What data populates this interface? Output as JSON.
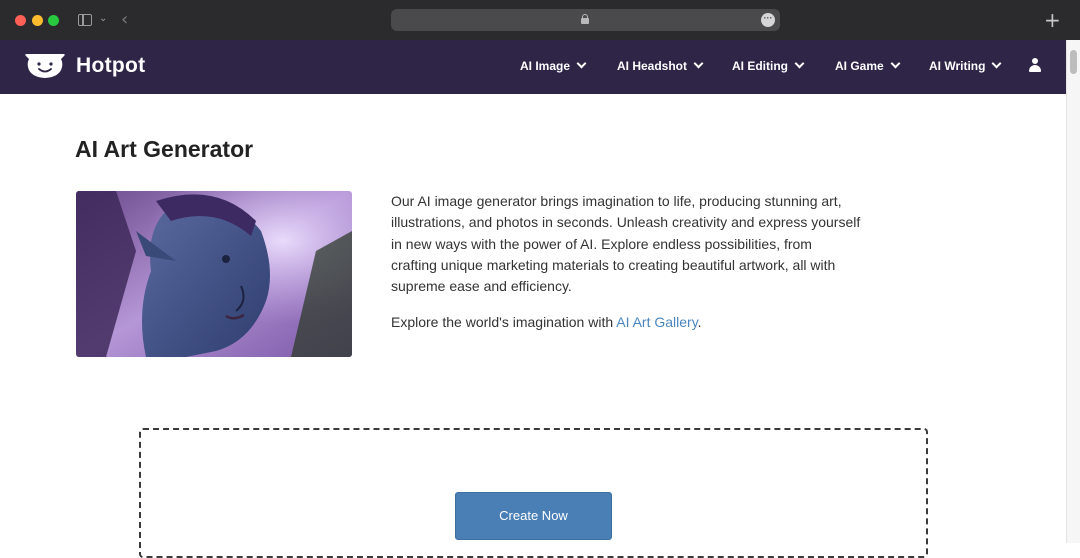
{
  "browser": {
    "icons": [
      "sidebar-toggle-icon",
      "chevron-down-icon",
      "back-arrow-icon",
      "lock-icon",
      "more-options-icon",
      "new-tab-icon"
    ]
  },
  "nav": {
    "brand": "Hotpot",
    "items": [
      {
        "label": "AI Image"
      },
      {
        "label": "AI Headshot"
      },
      {
        "label": "AI Editing"
      },
      {
        "label": "AI Game"
      },
      {
        "label": "AI Writing"
      }
    ],
    "background_color": "#2e2547"
  },
  "main": {
    "title": "AI Art Generator",
    "description": "Our AI image generator brings imagination to life, producing stunning art, illustrations, and photos in seconds. Unleash creativity and express yourself in new ways with the power of AI. Explore endless possibilities, from crafting unique marketing materials to creating beautiful artwork, all with supreme ease and efficiency.",
    "explore_prefix": "Explore the world's imagination with ",
    "explore_link": "AI Art Gallery",
    "explore_suffix": ".",
    "cta_label": "Create Now",
    "link_color": "#4a86bd",
    "button_color": "#4a7fb5"
  }
}
